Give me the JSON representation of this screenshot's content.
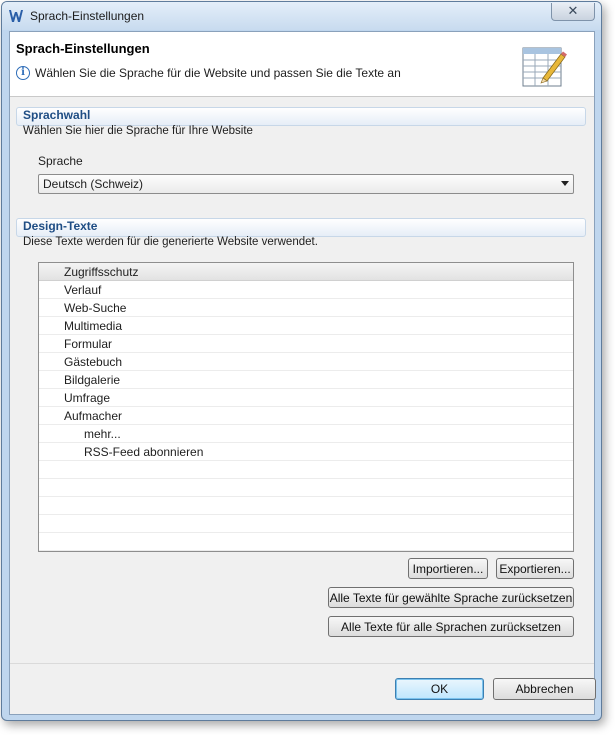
{
  "window": {
    "title": "Sprach-Einstellungen",
    "close_label": "✕"
  },
  "header": {
    "title": "Sprach-Einstellungen",
    "description": "Wählen Sie die Sprache für die Website und passen Sie die Texte an",
    "info_icon": "i"
  },
  "language_section": {
    "title": "Sprachwahl",
    "description": "Wählen Sie hier die Sprache für Ihre Website",
    "field_label": "Sprache",
    "selected": "Deutsch (Schweiz)"
  },
  "texts_section": {
    "title": "Design-Texte",
    "description": "Diese Texte werden für die generierte Website verwendet.",
    "items": [
      {
        "label": "Zugriffsschutz",
        "level": 1,
        "selected": true
      },
      {
        "label": "Verlauf",
        "level": 1
      },
      {
        "label": "Web-Suche",
        "level": 1
      },
      {
        "label": "Multimedia",
        "level": 1
      },
      {
        "label": "Formular",
        "level": 1
      },
      {
        "label": "Gästebuch",
        "level": 1
      },
      {
        "label": "Bildgalerie",
        "level": 1
      },
      {
        "label": "Umfrage",
        "level": 1
      },
      {
        "label": "Aufmacher",
        "level": 1
      },
      {
        "label": "mehr...",
        "level": 2
      },
      {
        "label": "RSS-Feed abonnieren",
        "level": 2
      }
    ]
  },
  "buttons": {
    "import": "Importieren...",
    "export": "Exportieren...",
    "reset_selected": "Alle Texte für gewählte Sprache zurücksetzen",
    "reset_all": "Alle Texte für alle Sprachen zurücksetzen",
    "ok": "OK",
    "cancel": "Abbrechen"
  }
}
